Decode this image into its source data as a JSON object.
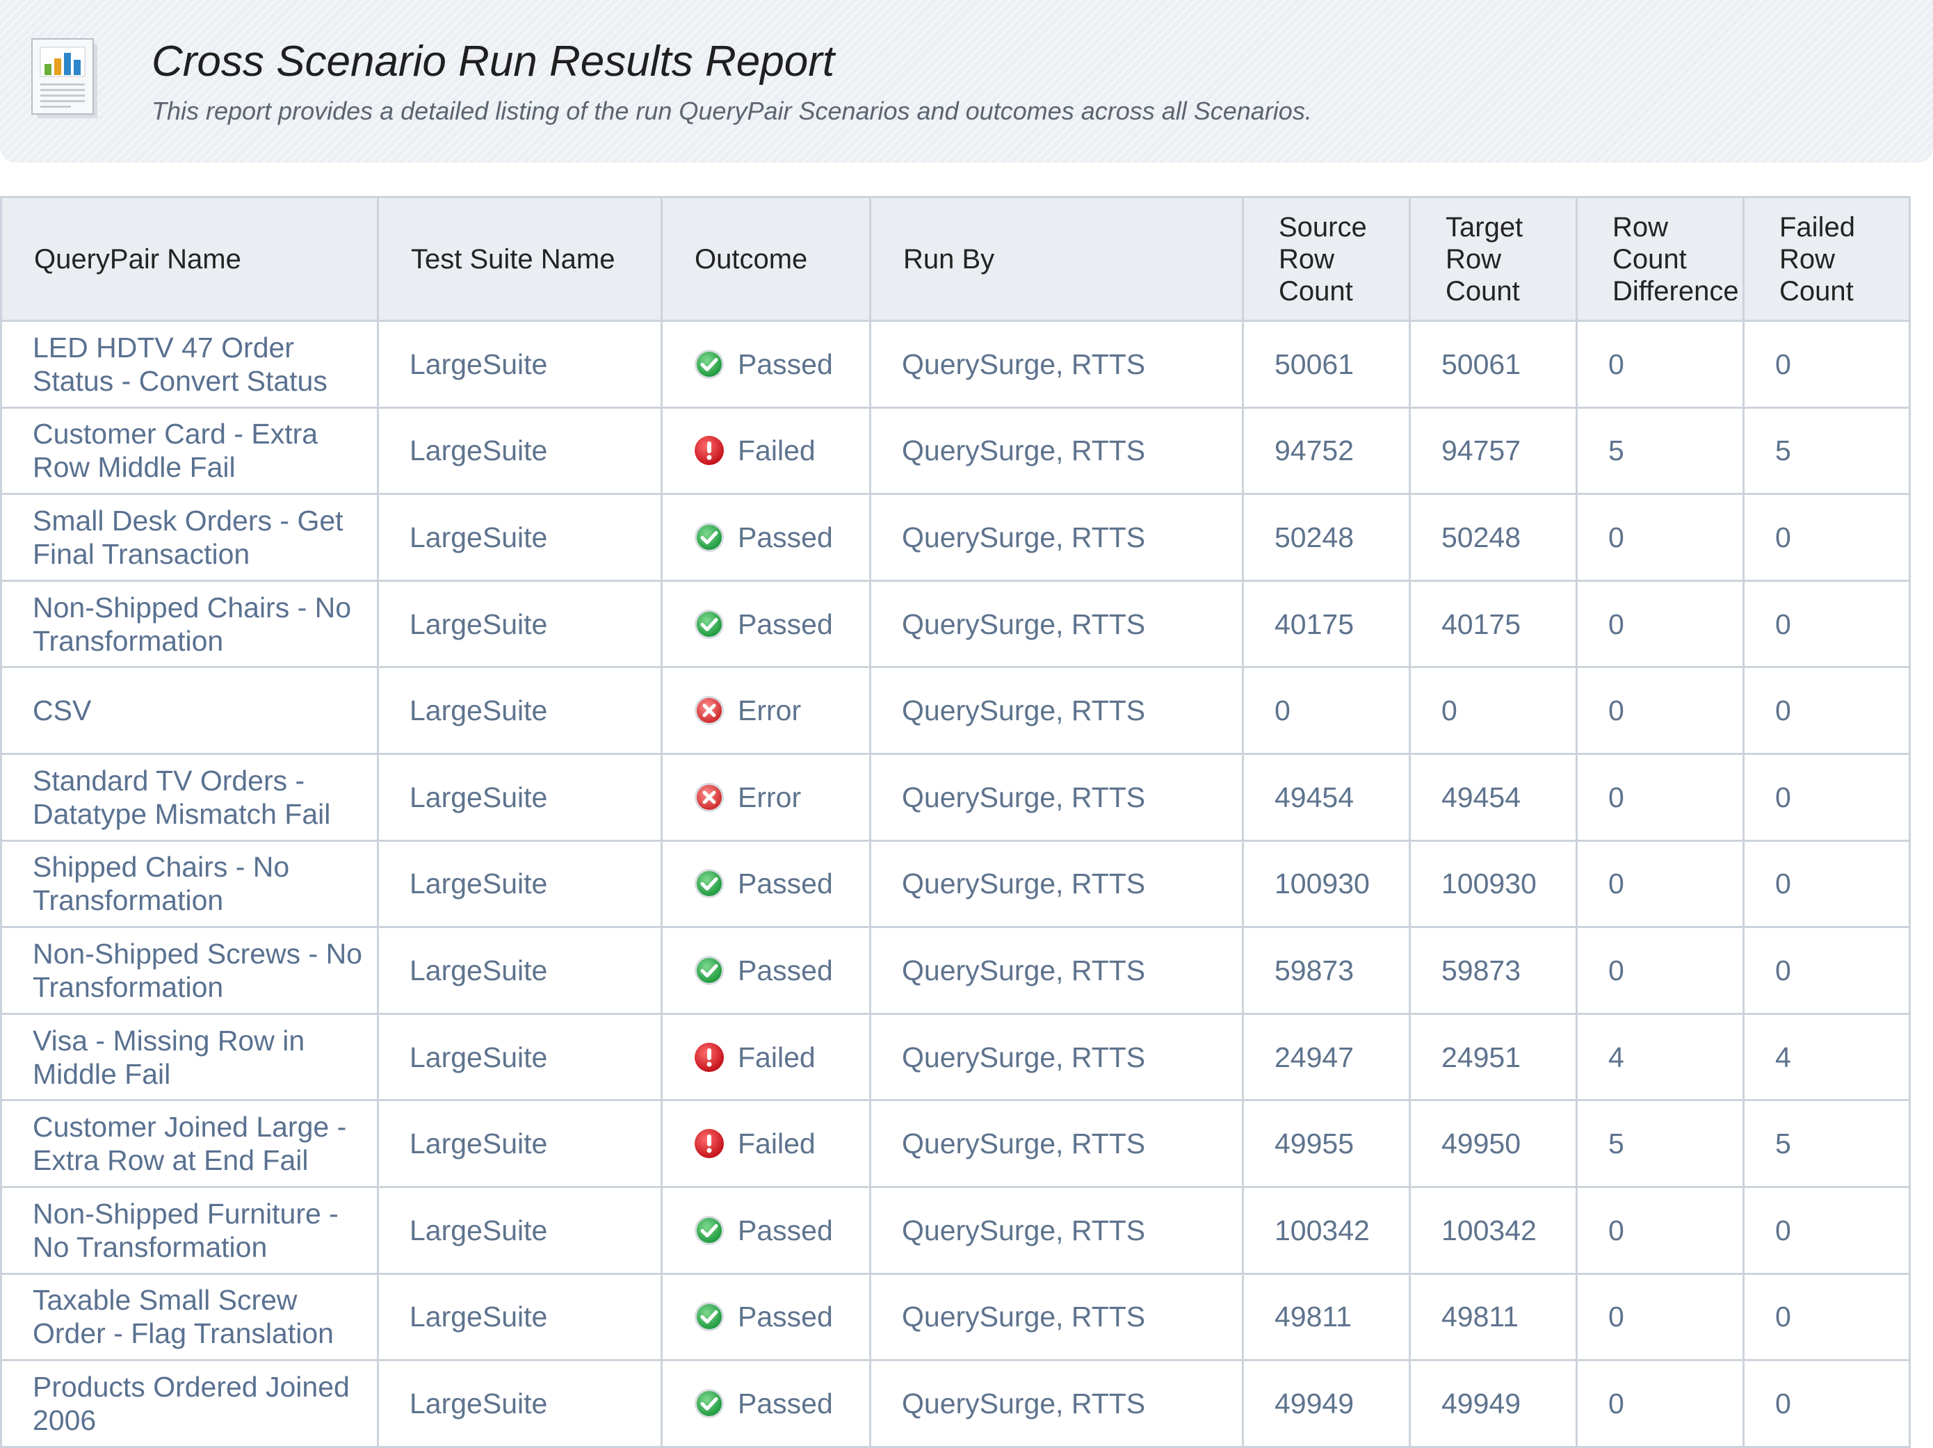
{
  "report": {
    "title": "Cross Scenario Run Results Report",
    "subtitle": "This report provides a detailed listing of the run QueryPair Scenarios and outcomes across all Scenarios.",
    "icon": "report-chart-icon"
  },
  "colors": {
    "passed": "#2da84a",
    "failed": "#d32027",
    "error": "#d93a3a",
    "text": "#5e738d",
    "header_bg": "#eaedf2",
    "border": "#cdd3dc"
  },
  "table": {
    "headers": [
      "QueryPair Name",
      "Test Suite Name",
      "Outcome",
      "Run By",
      "Source Row Count",
      "Target Row Count",
      "Row Count Difference",
      "Failed Row Count"
    ],
    "rows": [
      {
        "name": "LED HDTV 47 Order Status - Convert Status",
        "suite": "LargeSuite",
        "outcome": "Passed",
        "status_icon": "check-circle-icon",
        "run_by": "QuerySurge, RTTS",
        "source_count": "50061",
        "target_count": "50061",
        "row_diff": "0",
        "failed_count": "0"
      },
      {
        "name": "Customer Card - Extra Row Middle Fail",
        "suite": "LargeSuite",
        "outcome": "Failed",
        "status_icon": "exclamation-circle-icon",
        "run_by": "QuerySurge, RTTS",
        "source_count": "94752",
        "target_count": "94757",
        "row_diff": "5",
        "failed_count": "5"
      },
      {
        "name": "Small Desk Orders - Get Final Transaction",
        "suite": "LargeSuite",
        "outcome": "Passed",
        "status_icon": "check-circle-icon",
        "run_by": "QuerySurge, RTTS",
        "source_count": "50248",
        "target_count": "50248",
        "row_diff": "0",
        "failed_count": "0"
      },
      {
        "name": "Non-Shipped Chairs - No Transformation",
        "suite": "LargeSuite",
        "outcome": "Passed",
        "status_icon": "check-circle-icon",
        "run_by": "QuerySurge, RTTS",
        "source_count": "40175",
        "target_count": "40175",
        "row_diff": "0",
        "failed_count": "0"
      },
      {
        "name": "CSV",
        "suite": "LargeSuite",
        "outcome": "Error",
        "status_icon": "x-circle-icon",
        "run_by": "QuerySurge, RTTS",
        "source_count": "0",
        "target_count": "0",
        "row_diff": "0",
        "failed_count": "0"
      },
      {
        "name": "Standard TV Orders - Datatype Mismatch Fail",
        "suite": "LargeSuite",
        "outcome": "Error",
        "status_icon": "x-circle-icon",
        "run_by": "QuerySurge, RTTS",
        "source_count": "49454",
        "target_count": "49454",
        "row_diff": "0",
        "failed_count": "0"
      },
      {
        "name": "Shipped Chairs - No Transformation",
        "suite": "LargeSuite",
        "outcome": "Passed",
        "status_icon": "check-circle-icon",
        "run_by": "QuerySurge, RTTS",
        "source_count": "100930",
        "target_count": "100930",
        "row_diff": "0",
        "failed_count": "0"
      },
      {
        "name": "Non-Shipped Screws - No Transformation",
        "suite": "LargeSuite",
        "outcome": "Passed",
        "status_icon": "check-circle-icon",
        "run_by": "QuerySurge, RTTS",
        "source_count": "59873",
        "target_count": "59873",
        "row_diff": "0",
        "failed_count": "0"
      },
      {
        "name": "Visa - Missing Row in Middle Fail",
        "suite": "LargeSuite",
        "outcome": "Failed",
        "status_icon": "exclamation-circle-icon",
        "run_by": "QuerySurge, RTTS",
        "source_count": "24947",
        "target_count": "24951",
        "row_diff": "4",
        "failed_count": "4"
      },
      {
        "name": "Customer Joined Large - Extra Row at End Fail",
        "suite": "LargeSuite",
        "outcome": "Failed",
        "status_icon": "exclamation-circle-icon",
        "run_by": "QuerySurge, RTTS",
        "source_count": "49955",
        "target_count": "49950",
        "row_diff": "5",
        "failed_count": "5"
      },
      {
        "name": "Non-Shipped Furniture - No Transformation",
        "suite": "LargeSuite",
        "outcome": "Passed",
        "status_icon": "check-circle-icon",
        "run_by": "QuerySurge, RTTS",
        "source_count": "100342",
        "target_count": "100342",
        "row_diff": "0",
        "failed_count": "0"
      },
      {
        "name": "Taxable Small Screw Order - Flag Translation",
        "suite": "LargeSuite",
        "outcome": "Passed",
        "status_icon": "check-circle-icon",
        "run_by": "QuerySurge, RTTS",
        "source_count": "49811",
        "target_count": "49811",
        "row_diff": "0",
        "failed_count": "0"
      },
      {
        "name": "Products Ordered Joined 2006",
        "suite": "LargeSuite",
        "outcome": "Passed",
        "status_icon": "check-circle-icon",
        "run_by": "QuerySurge, RTTS",
        "source_count": "49949",
        "target_count": "49949",
        "row_diff": "0",
        "failed_count": "0"
      }
    ]
  }
}
